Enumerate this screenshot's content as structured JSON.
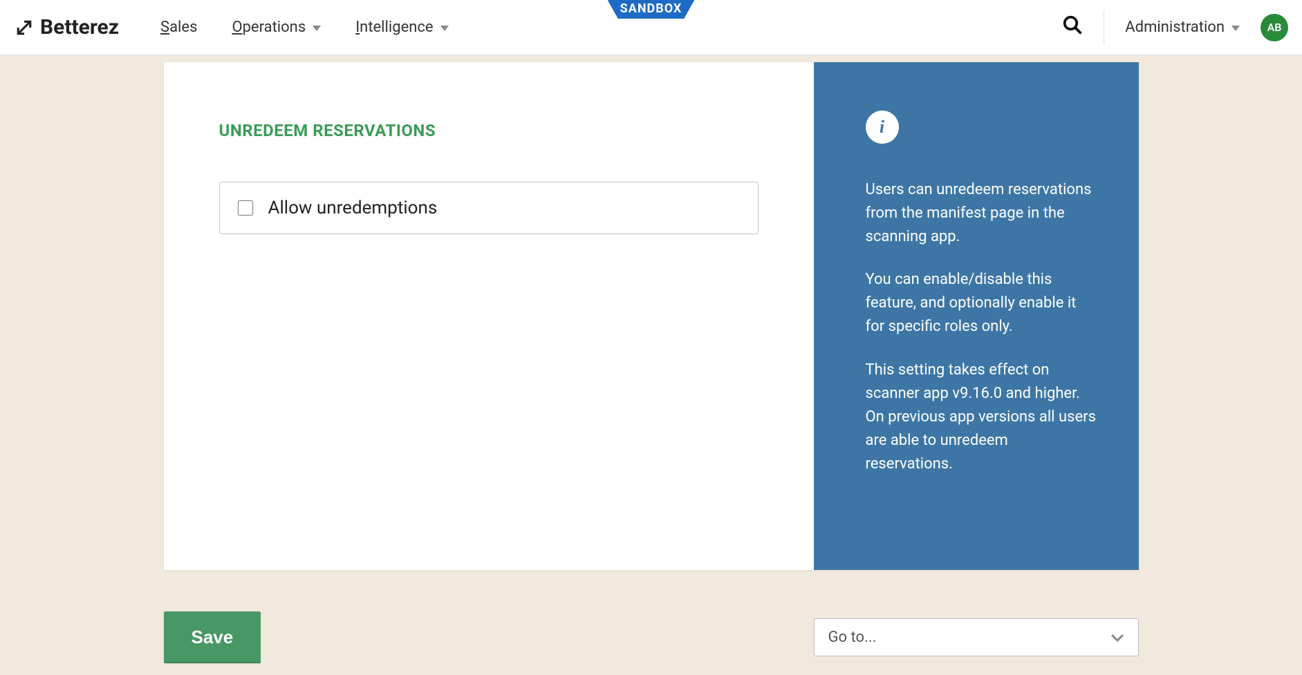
{
  "header": {
    "logo_text": "Betterez",
    "nav": [
      {
        "label": "Sales",
        "has_dropdown": false
      },
      {
        "label": "Operations",
        "has_dropdown": true
      },
      {
        "label": "Intelligence",
        "has_dropdown": true
      }
    ],
    "sandbox_badge": "SANDBOX",
    "admin_label": "Administration",
    "avatar_initials": "AB"
  },
  "main": {
    "section_title": "UNREDEEM RESERVATIONS",
    "checkbox_label": "Allow unredemptions",
    "checkbox_checked": false
  },
  "aside": {
    "paragraphs": [
      "Users can unredeem reservations from the manifest page in the scanning app.",
      "You can enable/disable this feature, and optionally enable it for specific roles only.",
      "This setting takes effect on scanner app v9.16.0 and higher. On previous app versions all users are able to unredeem reservations."
    ]
  },
  "footer": {
    "save_label": "Save",
    "goto_placeholder": "Go to..."
  }
}
